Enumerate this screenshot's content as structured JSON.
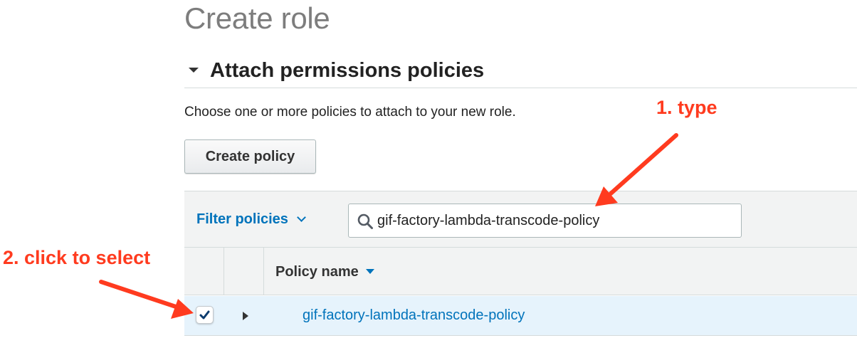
{
  "page": {
    "title": "Create role"
  },
  "section": {
    "title": "Attach permissions policies",
    "description": "Choose one or more policies to attach to your new role."
  },
  "toolbar": {
    "create_policy_label": "Create policy"
  },
  "filter": {
    "dropdown_label": "Filter policies",
    "dropdown_icon": "chevron-down-icon",
    "search_icon": "search-icon",
    "search_value": "gif-factory-lambda-transcode-policy"
  },
  "table": {
    "columns": [
      "Policy name"
    ],
    "sort_icon": "sort-desc-icon",
    "rows": [
      {
        "policy_name": "gif-factory-lambda-transcode-policy",
        "checked": true
      }
    ]
  },
  "annotations": {
    "step1": "1. type",
    "step2": "2. click to select",
    "color": "#ff3b1f"
  },
  "colors": {
    "link": "#0073bb",
    "selected_row": "#e6f3fc",
    "header_bg": "#f2f3f3"
  }
}
